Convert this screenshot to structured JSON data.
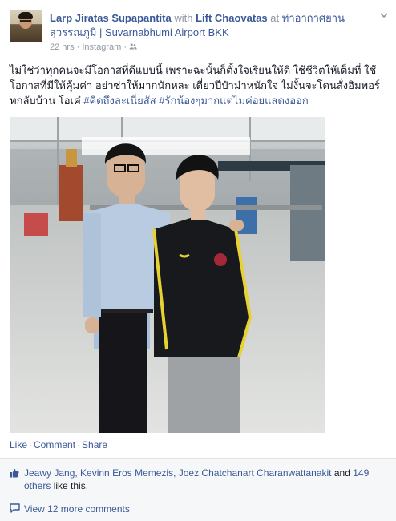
{
  "post": {
    "author": "Larp Jiratas Supapantita",
    "with_word": "with",
    "tagged": "Lift Chaovatas",
    "at_word": "at",
    "place": "ท่าอากาศยานสุวรรณภูมิ | Suvarnabhumi Airport BKK",
    "time": "22 hrs",
    "via": "Instagram",
    "text_line1": "ไม่ใช่ว่าทุกคนจะมีโอกาสที่ดีแบบนี้ เพราะฉะนั้นก็ตั้งใจเรียนให้ดี ใช้ชีวิตให้เต็มที่ ใช้",
    "text_line2": "โอกาสที่มีให้คุ้มค่า อย่าซ่าให้มากนักหละ เดี๋ยวปีป๋าม๋าหนักใจ ไม่งั้นจะโดนสั่งอิมพอร์",
    "text_line3_prefix": "ทกลับบ้าน โอเค๋ ",
    "hashtags": "#คิดถึงละเนี่ยสัส #รักน้องๆมากแต่ไม่ค่อยแสดงออก"
  },
  "actions": {
    "like": "Like",
    "comment": "Comment",
    "share": "Share"
  },
  "likes": {
    "names": "Jeawy Jang, Kevinn Eros Memezis, Joez Chatchanart Charanwattanakit",
    "and_word": "and",
    "others_count": "149",
    "others_word": "others",
    "suffix": "like this."
  },
  "comments": {
    "view_more": "View 12 more comments"
  },
  "colors": {
    "link": "#3b5998",
    "muted": "#9197a3",
    "panel": "#f6f7f8"
  },
  "icons": [
    "chevron-down-icon",
    "globe-icon",
    "thumbs-up-icon",
    "comment-bubble-icon"
  ]
}
